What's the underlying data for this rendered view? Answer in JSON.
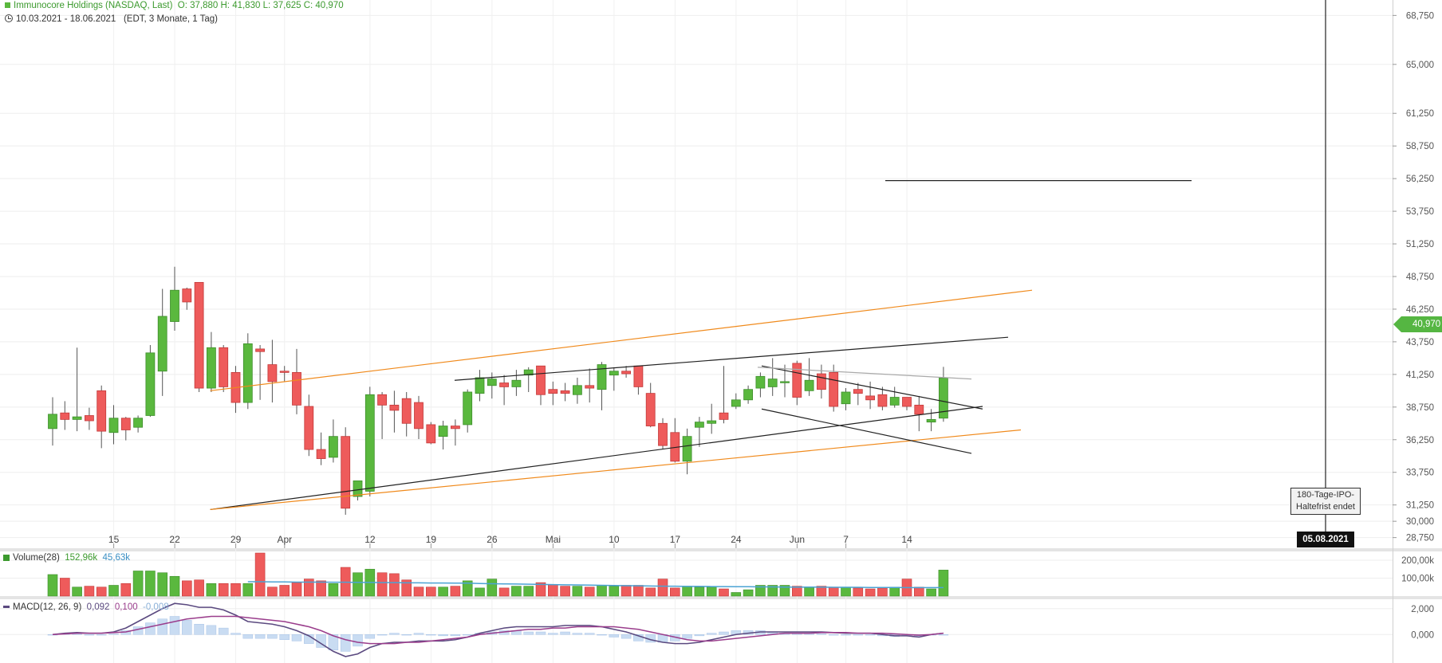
{
  "header": {
    "title": "Immunocore Holdings (NASDAQ, Last)",
    "ohlc": "O: 37,880  H: 41,830  L: 37,625  C: 40,970",
    "range": "10.03.2021 - 18.06.2021",
    "info": "(EDT, 3 Monate, 1 Tag)"
  },
  "last_price_label": "40,970",
  "ipo_annotation": {
    "line1": "180-Tage-IPO-",
    "line2": "Haltefrist endet"
  },
  "event_date_label": "05.08.2021",
  "colors": {
    "up": "#5ab83e",
    "down": "#ee5b5b",
    "orange_line": "#f08a1c",
    "volume_ma": "#4ba3d4",
    "macd": "#5b4a80",
    "signal": "#9a3d8c",
    "histogram": "#c9dcf2"
  },
  "chart_data": [
    {
      "type": "candlestick",
      "title": "Immunocore Holdings (NASDAQ, Last)",
      "x_tick_labels": [
        "15",
        "22",
        "29",
        "Apr",
        "12",
        "19",
        "26",
        "Mai",
        "10",
        "17",
        "24",
        "Jun",
        "7",
        "14"
      ],
      "y_tick_labels": [
        "68,750",
        "65,000",
        "61,250",
        "58,750",
        "56,250",
        "53,750",
        "51,250",
        "48,750",
        "46,250",
        "43,750",
        "41,250",
        "38,750",
        "36,250",
        "33,750",
        "31,250",
        "30,000",
        "28,750"
      ],
      "ylim": [
        28.3,
        69.2
      ],
      "candles": [
        [
          37.1,
          38.2,
          39.5,
          35.8
        ],
        [
          38.3,
          37.8,
          39.2,
          37.0
        ],
        [
          37.8,
          38.0,
          43.3,
          36.9
        ],
        [
          38.1,
          37.7,
          38.7,
          37.0
        ],
        [
          40.0,
          36.9,
          40.4,
          35.6
        ],
        [
          36.8,
          37.9,
          38.9,
          35.9
        ],
        [
          37.9,
          37.0,
          38.0,
          36.2
        ],
        [
          37.2,
          37.9,
          38.1,
          36.8
        ],
        [
          38.1,
          42.9,
          43.5,
          38.0
        ],
        [
          41.5,
          45.7,
          47.8,
          39.6
        ],
        [
          45.3,
          47.7,
          49.5,
          44.6
        ],
        [
          47.8,
          46.8,
          47.9,
          46.2
        ],
        [
          48.3,
          40.2,
          48.3,
          39.9
        ],
        [
          40.2,
          43.3,
          44.5,
          39.9
        ],
        [
          43.3,
          40.3,
          43.5,
          39.9
        ],
        [
          41.4,
          39.1,
          41.9,
          38.3
        ],
        [
          39.1,
          43.6,
          44.4,
          38.6
        ],
        [
          43.2,
          43.0,
          43.5,
          39.3
        ],
        [
          42.0,
          40.7,
          43.9,
          39.1
        ],
        [
          41.5,
          41.4,
          41.9,
          40.7
        ],
        [
          41.4,
          38.9,
          43.2,
          38.2
        ],
        [
          38.8,
          35.5,
          39.7,
          35.0
        ],
        [
          35.5,
          34.8,
          36.8,
          34.3
        ],
        [
          34.9,
          36.5,
          37.8,
          34.5
        ],
        [
          36.5,
          31.0,
          37.2,
          30.5
        ],
        [
          31.9,
          33.1,
          33.1,
          31.6
        ],
        [
          32.3,
          39.7,
          40.3,
          31.9
        ],
        [
          39.7,
          38.9,
          39.9,
          36.3
        ],
        [
          38.9,
          38.5,
          40.0,
          36.8
        ],
        [
          39.4,
          37.5,
          39.9,
          36.5
        ],
        [
          39.1,
          37.1,
          39.6,
          36.3
        ],
        [
          37.4,
          36.0,
          37.6,
          35.9
        ],
        [
          36.5,
          37.3,
          37.7,
          35.5
        ],
        [
          37.3,
          37.1,
          37.8,
          35.8
        ],
        [
          37.4,
          39.9,
          40.1,
          36.8
        ],
        [
          39.8,
          41.0,
          41.6,
          39.2
        ],
        [
          40.4,
          40.9,
          41.4,
          39.4
        ],
        [
          40.6,
          40.3,
          41.2,
          38.9
        ],
        [
          40.3,
          40.8,
          41.6,
          39.6
        ],
        [
          41.2,
          41.6,
          41.8,
          39.9
        ],
        [
          41.9,
          39.7,
          41.9,
          38.9
        ],
        [
          40.1,
          39.8,
          40.7,
          38.9
        ],
        [
          40.0,
          39.8,
          40.6,
          39.2
        ],
        [
          39.7,
          40.4,
          41.0,
          39.0
        ],
        [
          40.4,
          40.2,
          41.7,
          39.1
        ],
        [
          40.1,
          42.0,
          42.2,
          38.5
        ],
        [
          41.2,
          41.5,
          41.8,
          40.0
        ],
        [
          41.5,
          41.3,
          41.9,
          41.0
        ],
        [
          41.9,
          40.3,
          41.9,
          39.7
        ],
        [
          39.8,
          37.3,
          40.6,
          37.2
        ],
        [
          37.5,
          35.8,
          37.9,
          35.5
        ],
        [
          36.8,
          34.6,
          37.9,
          34.5
        ],
        [
          34.6,
          36.5,
          37.1,
          33.6
        ],
        [
          37.2,
          37.6,
          38.0,
          35.7
        ],
        [
          37.5,
          37.7,
          39.0,
          36.7
        ],
        [
          38.3,
          37.8,
          41.9,
          37.5
        ],
        [
          38.8,
          39.3,
          39.8,
          38.6
        ],
        [
          39.3,
          40.1,
          40.4,
          39.0
        ],
        [
          40.2,
          41.1,
          41.4,
          39.5
        ],
        [
          40.3,
          40.9,
          42.5,
          39.6
        ],
        [
          40.7,
          40.7,
          42.0,
          39.5
        ],
        [
          42.1,
          39.5,
          42.3,
          38.9
        ],
        [
          40.0,
          40.8,
          42.5,
          39.6
        ],
        [
          41.3,
          40.1,
          42.0,
          39.4
        ],
        [
          41.4,
          38.8,
          42.0,
          38.4
        ],
        [
          39.0,
          39.9,
          40.2,
          38.5
        ],
        [
          40.1,
          39.8,
          40.6,
          38.9
        ],
        [
          39.6,
          39.3,
          40.7,
          38.6
        ],
        [
          39.7,
          38.8,
          40.3,
          38.5
        ],
        [
          38.9,
          39.5,
          40.3,
          38.7
        ],
        [
          39.5,
          38.8,
          39.5,
          38.5
        ],
        [
          38.9,
          38.2,
          39.6,
          36.9
        ],
        [
          37.6,
          37.8,
          38.6,
          36.9
        ],
        [
          37.9,
          40.97,
          41.83,
          37.625
        ]
      ],
      "trendlines": [
        {
          "color": "black",
          "points": [
            [
              12,
              30.9
            ],
            [
              66,
              38.8
            ]
          ]
        },
        {
          "color": "black",
          "points": [
            [
              27,
              40.8
            ],
            [
              68,
              44.1
            ]
          ]
        },
        {
          "color": "orange",
          "points": [
            [
              12,
              40.0
            ],
            [
              69,
              47.7
            ]
          ]
        },
        {
          "color": "orange",
          "points": [
            [
              12,
              30.9
            ],
            [
              66,
              37.0
            ]
          ]
        },
        {
          "color": "black",
          "points": [
            [
              62,
              41.9
            ],
            [
              64,
              38.6
            ]
          ]
        },
        {
          "color": "black",
          "points": [
            [
              62,
              38.6
            ],
            [
              65,
              35.2
            ]
          ]
        },
        {
          "color": "gray",
          "points": [
            [
              63,
              41.8
            ],
            [
              65,
              40.9
            ]
          ]
        },
        {
          "color": "black",
          "points": [
            [
              68,
              56.1
            ],
            [
              72,
              56.1
            ]
          ]
        }
      ]
    },
    {
      "type": "bar",
      "title": "Volume(28)",
      "values_text": [
        "152,96k",
        "45,63k"
      ],
      "y_tick_labels": [
        "200,00k",
        "100,00k"
      ],
      "ylim": [
        0,
        240
      ],
      "values": [
        120,
        100,
        50,
        55,
        50,
        60,
        70,
        140,
        140,
        130,
        110,
        85,
        90,
        70,
        70,
        70,
        70,
        240,
        50,
        60,
        75,
        95,
        85,
        70,
        160,
        130,
        150,
        130,
        125,
        90,
        50,
        50,
        50,
        55,
        85,
        45,
        95,
        45,
        55,
        55,
        75,
        65,
        55,
        55,
        50,
        60,
        55,
        60,
        60,
        45,
        95,
        45,
        55,
        50,
        50,
        40,
        20,
        35,
        60,
        60,
        60,
        55,
        50,
        55,
        50,
        50,
        45,
        40,
        45,
        50,
        95,
        50,
        40,
        145
      ],
      "ma_values": [
        80,
        80,
        79,
        79,
        78,
        78,
        78,
        77,
        77,
        76,
        76,
        75,
        75,
        74,
        74,
        73,
        73,
        72,
        72,
        70,
        69,
        68,
        67,
        66,
        65,
        64,
        63,
        62,
        61,
        60,
        59,
        58,
        57,
        56,
        55,
        55,
        54,
        54,
        53,
        53,
        52,
        52,
        51,
        51,
        50,
        50,
        50,
        50,
        49,
        49,
        49,
        48,
        48,
        48,
        47,
        47,
        47,
        47
      ]
    },
    {
      "type": "line",
      "title": "MACD(12, 26, 9)",
      "values_text": [
        "0,092",
        "0,100",
        "-0,008"
      ],
      "y_tick_labels": [
        "2,000",
        "0,000"
      ],
      "ylim": [
        -2.2,
        2.6
      ],
      "series": [
        {
          "name": "MACD(12, 26, 9)",
          "values": [
            0.0,
            0.1,
            0.15,
            0.1,
            0.1,
            0.2,
            0.5,
            1.0,
            1.5,
            2.0,
            2.4,
            2.3,
            2.1,
            2.1,
            1.9,
            1.5,
            1.0,
            0.9,
            0.8,
            0.6,
            0.3,
            -0.1,
            -0.7,
            -1.3,
            -1.7,
            -1.5,
            -1.0,
            -0.7,
            -0.6,
            -0.6,
            -0.5,
            -0.5,
            -0.5,
            -0.4,
            -0.2,
            0.1,
            0.3,
            0.5,
            0.6,
            0.6,
            0.6,
            0.6,
            0.7,
            0.7,
            0.7,
            0.6,
            0.4,
            0.2,
            -0.1,
            -0.4,
            -0.6,
            -0.7,
            -0.7,
            -0.6,
            -0.4,
            -0.2,
            0.0,
            0.1,
            0.2,
            0.2,
            0.2,
            0.2,
            0.2,
            0.2,
            0.15,
            0.1,
            0.1,
            0.1,
            0.0,
            -0.1,
            -0.1,
            -0.2,
            0.0,
            0.1
          ]
        },
        {
          "name": "Signal",
          "values": [
            0.0,
            0.05,
            0.1,
            0.1,
            0.1,
            0.15,
            0.2,
            0.4,
            0.6,
            0.8,
            1.0,
            1.2,
            1.3,
            1.4,
            1.4,
            1.4,
            1.3,
            1.2,
            1.1,
            1.0,
            0.8,
            0.6,
            0.3,
            -0.1,
            -0.4,
            -0.6,
            -0.7,
            -0.7,
            -0.7,
            -0.6,
            -0.6,
            -0.5,
            -0.4,
            -0.3,
            -0.2,
            0.0,
            0.1,
            0.2,
            0.3,
            0.4,
            0.4,
            0.5,
            0.5,
            0.6,
            0.6,
            0.6,
            0.6,
            0.5,
            0.4,
            0.2,
            0.0,
            -0.2,
            -0.4,
            -0.5,
            -0.5,
            -0.4,
            -0.3,
            -0.2,
            -0.1,
            0.0,
            0.1,
            0.1,
            0.1,
            0.15,
            0.15,
            0.15,
            0.1,
            0.1,
            0.1,
            0.05,
            0.0,
            -0.05,
            0.0,
            0.1
          ]
        }
      ]
    }
  ]
}
